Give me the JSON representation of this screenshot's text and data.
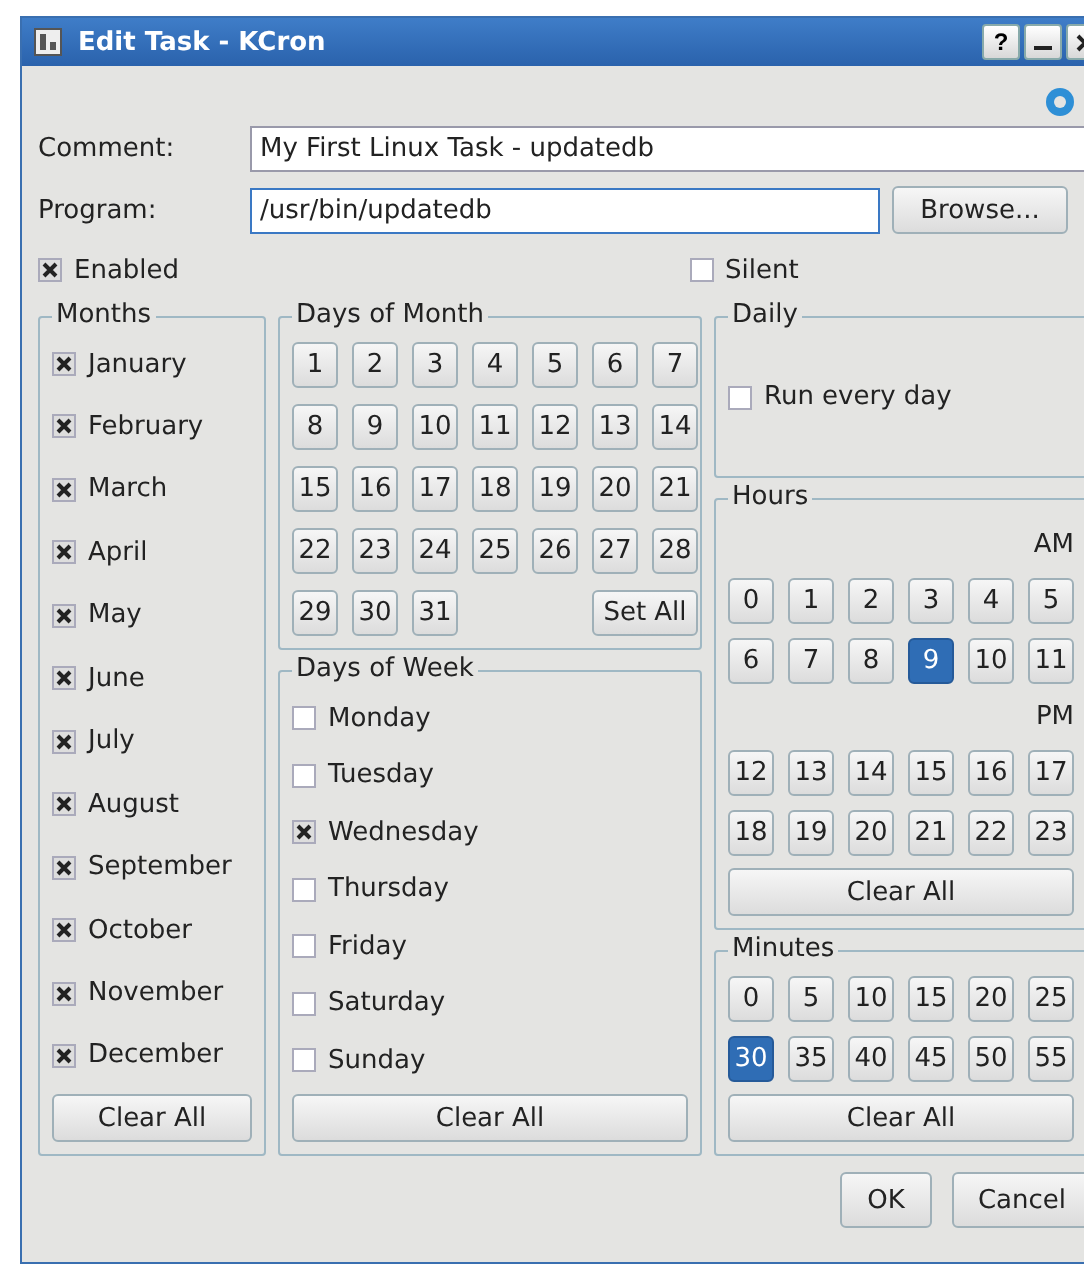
{
  "window": {
    "title": "Edit Task - KCron",
    "help_button": "?"
  },
  "comment": {
    "label": "Comment:",
    "value": "My First Linux Task - updatedb"
  },
  "program": {
    "label": "Program:",
    "value": "/usr/bin/updatedb"
  },
  "browse_button": "Browse...",
  "enabled": {
    "label": "Enabled",
    "checked": true
  },
  "silent": {
    "label": "Silent",
    "checked": false
  },
  "months": {
    "title": "Months",
    "items": [
      {
        "label": "January",
        "checked": true
      },
      {
        "label": "February",
        "checked": true
      },
      {
        "label": "March",
        "checked": true
      },
      {
        "label": "April",
        "checked": true
      },
      {
        "label": "May",
        "checked": true
      },
      {
        "label": "June",
        "checked": true
      },
      {
        "label": "July",
        "checked": true
      },
      {
        "label": "August",
        "checked": true
      },
      {
        "label": "September",
        "checked": true
      },
      {
        "label": "October",
        "checked": true
      },
      {
        "label": "November",
        "checked": true
      },
      {
        "label": "December",
        "checked": true
      }
    ],
    "clear_button": "Clear All"
  },
  "days_of_month": {
    "title": "Days of Month",
    "days": [
      {
        "label": "1",
        "selected": false
      },
      {
        "label": "2",
        "selected": false
      },
      {
        "label": "3",
        "selected": false
      },
      {
        "label": "4",
        "selected": false
      },
      {
        "label": "5",
        "selected": false
      },
      {
        "label": "6",
        "selected": false
      },
      {
        "label": "7",
        "selected": false
      },
      {
        "label": "8",
        "selected": false
      },
      {
        "label": "9",
        "selected": false
      },
      {
        "label": "10",
        "selected": false
      },
      {
        "label": "11",
        "selected": false
      },
      {
        "label": "12",
        "selected": false
      },
      {
        "label": "13",
        "selected": false
      },
      {
        "label": "14",
        "selected": false
      },
      {
        "label": "15",
        "selected": false
      },
      {
        "label": "16",
        "selected": false
      },
      {
        "label": "17",
        "selected": false
      },
      {
        "label": "18",
        "selected": false
      },
      {
        "label": "19",
        "selected": false
      },
      {
        "label": "20",
        "selected": false
      },
      {
        "label": "21",
        "selected": false
      },
      {
        "label": "22",
        "selected": false
      },
      {
        "label": "23",
        "selected": false
      },
      {
        "label": "24",
        "selected": false
      },
      {
        "label": "25",
        "selected": false
      },
      {
        "label": "26",
        "selected": false
      },
      {
        "label": "27",
        "selected": false
      },
      {
        "label": "28",
        "selected": false
      },
      {
        "label": "29",
        "selected": false
      },
      {
        "label": "30",
        "selected": false
      },
      {
        "label": "31",
        "selected": false
      }
    ],
    "set_all_button": "Set All"
  },
  "days_of_week": {
    "title": "Days of Week",
    "items": [
      {
        "label": "Monday",
        "checked": false
      },
      {
        "label": "Tuesday",
        "checked": false
      },
      {
        "label": "Wednesday",
        "checked": true
      },
      {
        "label": "Thursday",
        "checked": false
      },
      {
        "label": "Friday",
        "checked": false
      },
      {
        "label": "Saturday",
        "checked": false
      },
      {
        "label": "Sunday",
        "checked": false
      }
    ],
    "clear_button": "Clear All"
  },
  "daily": {
    "title": "Daily",
    "run_every_day": {
      "label": "Run every day",
      "checked": false
    }
  },
  "hours": {
    "title": "Hours",
    "am_label": "AM",
    "am": [
      {
        "label": "0",
        "selected": false
      },
      {
        "label": "1",
        "selected": false
      },
      {
        "label": "2",
        "selected": false
      },
      {
        "label": "3",
        "selected": false
      },
      {
        "label": "4",
        "selected": false
      },
      {
        "label": "5",
        "selected": false
      },
      {
        "label": "6",
        "selected": false
      },
      {
        "label": "7",
        "selected": false
      },
      {
        "label": "8",
        "selected": false
      },
      {
        "label": "9",
        "selected": true
      },
      {
        "label": "10",
        "selected": false
      },
      {
        "label": "11",
        "selected": false
      }
    ],
    "pm_label": "PM",
    "pm": [
      {
        "label": "12",
        "selected": false
      },
      {
        "label": "13",
        "selected": false
      },
      {
        "label": "14",
        "selected": false
      },
      {
        "label": "15",
        "selected": false
      },
      {
        "label": "16",
        "selected": false
      },
      {
        "label": "17",
        "selected": false
      },
      {
        "label": "18",
        "selected": false
      },
      {
        "label": "19",
        "selected": false
      },
      {
        "label": "20",
        "selected": false
      },
      {
        "label": "21",
        "selected": false
      },
      {
        "label": "22",
        "selected": false
      },
      {
        "label": "23",
        "selected": false
      }
    ],
    "clear_button": "Clear All"
  },
  "minutes": {
    "title": "Minutes",
    "items": [
      {
        "label": "0",
        "selected": false
      },
      {
        "label": "5",
        "selected": false
      },
      {
        "label": "10",
        "selected": false
      },
      {
        "label": "15",
        "selected": false
      },
      {
        "label": "20",
        "selected": false
      },
      {
        "label": "25",
        "selected": false
      },
      {
        "label": "30",
        "selected": true
      },
      {
        "label": "35",
        "selected": false
      },
      {
        "label": "40",
        "selected": false
      },
      {
        "label": "45",
        "selected": false
      },
      {
        "label": "50",
        "selected": false
      },
      {
        "label": "55",
        "selected": false
      }
    ],
    "clear_button": "Clear All"
  },
  "buttons": [
    "OK",
    "Cancel"
  ]
}
